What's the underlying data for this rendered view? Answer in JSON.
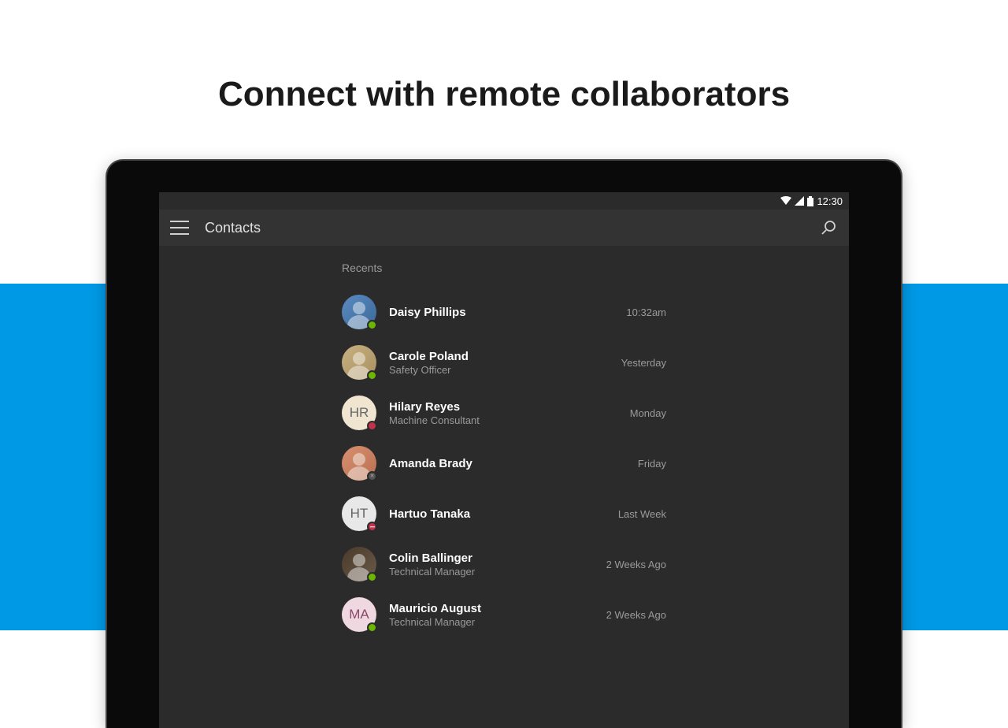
{
  "headline": "Connect with remote collaborators",
  "status": {
    "time": "12:30"
  },
  "app": {
    "title": "Contacts",
    "section": "Recents"
  },
  "contacts": [
    {
      "name": "Daisy Phillips",
      "role": "",
      "time": "10:32am",
      "initials": "",
      "presence": "available",
      "avatar_class": "p1"
    },
    {
      "name": "Carole Poland",
      "role": "Safety Officer",
      "time": "Yesterday",
      "initials": "",
      "presence": "available",
      "avatar_class": "p2"
    },
    {
      "name": "Hilary Reyes",
      "role": "Machine Consultant",
      "time": "Monday",
      "initials": "HR",
      "presence": "busy",
      "avatar_class": "p3"
    },
    {
      "name": "Amanda Brady",
      "role": "",
      "time": "Friday",
      "initials": "",
      "presence": "offline",
      "avatar_class": "p4"
    },
    {
      "name": "Hartuo Tanaka",
      "role": "",
      "time": "Last Week",
      "initials": "HT",
      "presence": "dnd",
      "avatar_class": "p5"
    },
    {
      "name": "Colin Ballinger",
      "role": "Technical Manager",
      "time": "2 Weeks Ago",
      "initials": "",
      "presence": "available",
      "avatar_class": "p6"
    },
    {
      "name": "Mauricio August",
      "role": "Technical Manager",
      "time": "2 Weeks Ago",
      "initials": "MA",
      "presence": "available",
      "avatar_class": "p7"
    }
  ]
}
